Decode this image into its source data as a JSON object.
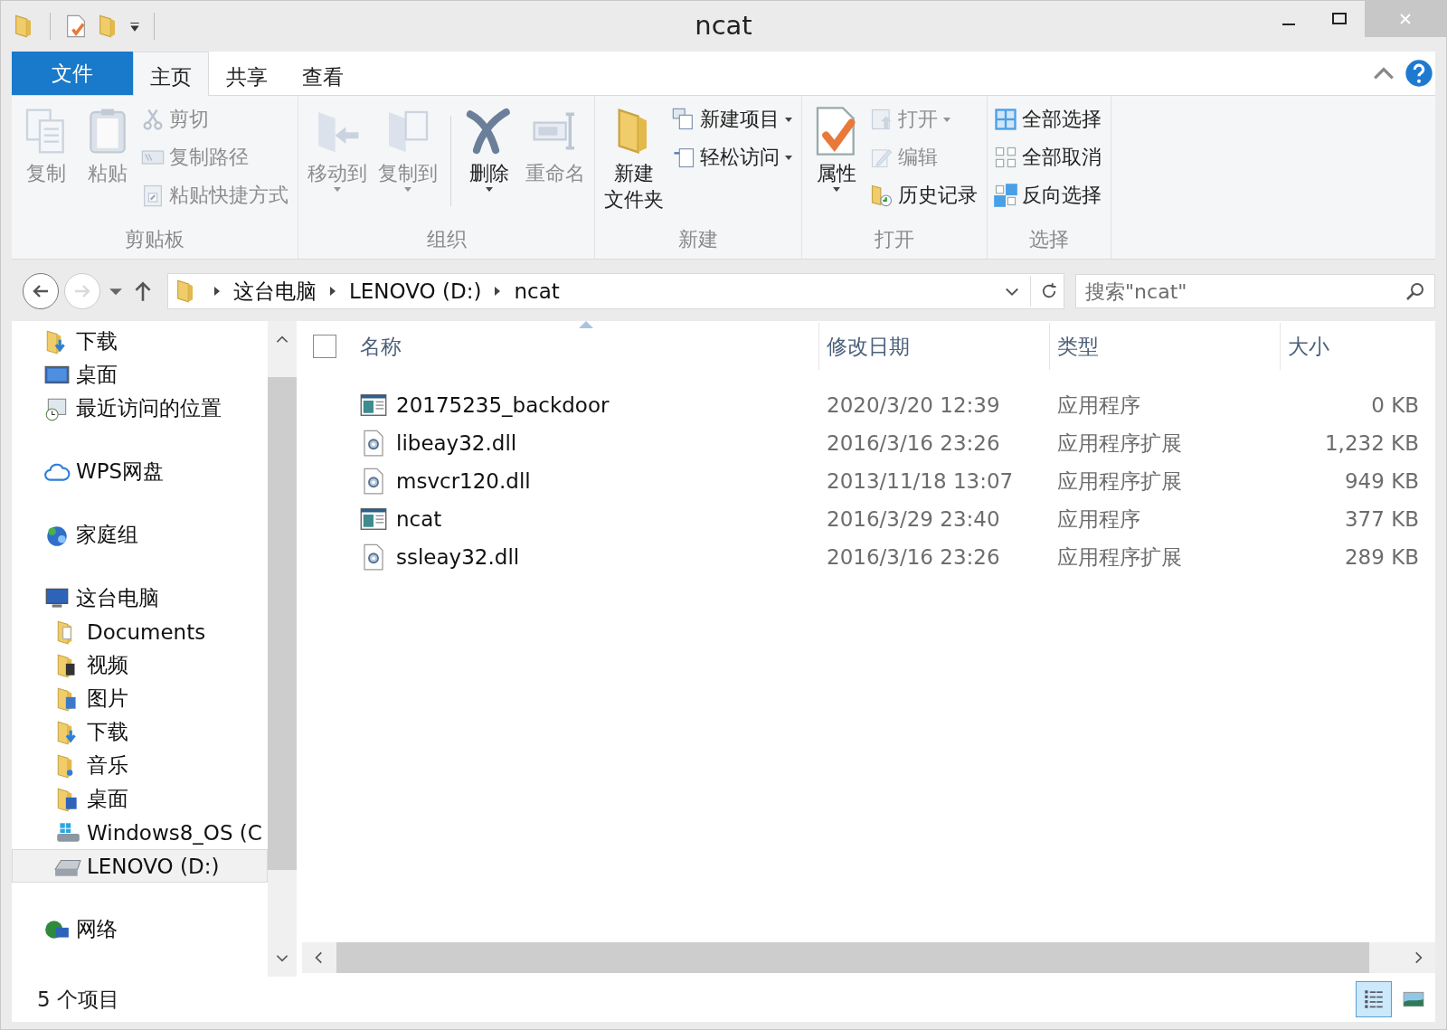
{
  "window": {
    "title": "ncat"
  },
  "tabs": [
    {
      "label": "文件",
      "kind": "file",
      "selected": false
    },
    {
      "label": "主页",
      "kind": "tab",
      "selected": true
    },
    {
      "label": "共享",
      "kind": "tab",
      "selected": false
    },
    {
      "label": "查看",
      "kind": "tab",
      "selected": false
    }
  ],
  "ribbon": {
    "groups": [
      {
        "label": "剪贴板",
        "items": [
          {
            "kind": "large",
            "lines": [
              "复制"
            ],
            "disabled": true,
            "dropdown": false
          },
          {
            "kind": "large",
            "lines": [
              "粘贴"
            ],
            "disabled": true,
            "dropdown": false
          },
          {
            "kind": "stack",
            "items": [
              {
                "label": "剪切",
                "disabled": true,
                "dropdown": false
              },
              {
                "label": "复制路径",
                "disabled": true,
                "dropdown": false
              },
              {
                "label": "粘贴快捷方式",
                "disabled": true,
                "dropdown": false
              }
            ]
          }
        ]
      },
      {
        "label": "组织",
        "items": [
          {
            "kind": "large",
            "lines": [
              "移动到"
            ],
            "disabled": true,
            "dropdown": true
          },
          {
            "kind": "large",
            "lines": [
              "复制到"
            ],
            "disabled": true,
            "dropdown": true
          },
          {
            "kind": "large",
            "lines": [
              "删除"
            ],
            "disabled": false,
            "dropdown": true
          },
          {
            "kind": "large",
            "lines": [
              "重命名"
            ],
            "disabled": true,
            "dropdown": false
          }
        ]
      },
      {
        "label": "新建",
        "items": [
          {
            "kind": "large",
            "lines": [
              "新建",
              "文件夹"
            ],
            "disabled": false,
            "dropdown": false
          },
          {
            "kind": "stack",
            "items": [
              {
                "label": "新建项目",
                "disabled": false,
                "dropdown": true
              },
              {
                "label": "轻松访问",
                "disabled": false,
                "dropdown": true
              }
            ]
          }
        ]
      },
      {
        "label": "打开",
        "items": [
          {
            "kind": "large",
            "lines": [
              "属性"
            ],
            "disabled": false,
            "dropdown": true
          },
          {
            "kind": "stack",
            "items": [
              {
                "label": "打开",
                "disabled": true,
                "dropdown": true
              },
              {
                "label": "编辑",
                "disabled": true,
                "dropdown": false
              },
              {
                "label": "历史记录",
                "disabled": false,
                "dropdown": false
              }
            ]
          }
        ]
      },
      {
        "label": "选择",
        "items": [
          {
            "kind": "stack",
            "items": [
              {
                "label": "全部选择",
                "disabled": false,
                "dropdown": false
              },
              {
                "label": "全部取消",
                "disabled": false,
                "dropdown": false
              },
              {
                "label": "反向选择",
                "disabled": false,
                "dropdown": false
              }
            ]
          }
        ]
      }
    ]
  },
  "navigation": {
    "back_disabled": false,
    "forward_disabled": true
  },
  "breadcrumb": [
    "这台电脑",
    "LENOVO (D:)",
    "ncat"
  ],
  "search": {
    "placeholder": "搜索\"ncat\""
  },
  "sidebar": {
    "items": [
      {
        "label": "下载",
        "kind": "downloads",
        "selected": false
      },
      {
        "label": "桌面",
        "kind": "desktop",
        "selected": false
      },
      {
        "label": "最近访问的位置",
        "kind": "recent",
        "selected": false
      },
      {
        "label": "WPS网盘",
        "kind": "cloud",
        "selected": false
      },
      {
        "label": "家庭组",
        "kind": "homegroup",
        "selected": false
      },
      {
        "label": "这台电脑",
        "kind": "computer",
        "selected": false,
        "children": [
          {
            "label": "Documents",
            "kind": "documents",
            "selected": false
          },
          {
            "label": "视频",
            "kind": "videos",
            "selected": false
          },
          {
            "label": "图片",
            "kind": "pictures",
            "selected": false
          },
          {
            "label": "下载",
            "kind": "downloads",
            "selected": false
          },
          {
            "label": "音乐",
            "kind": "music",
            "selected": false
          },
          {
            "label": "桌面",
            "kind": "desktopfolder",
            "selected": false
          },
          {
            "label": "Windows8_OS (C",
            "kind": "osdrive",
            "selected": false
          },
          {
            "label": "LENOVO (D:)",
            "kind": "drive",
            "selected": true
          }
        ]
      },
      {
        "label": "网络",
        "kind": "network",
        "selected": false
      }
    ]
  },
  "table": {
    "select_all": {
      "checked": false
    },
    "columns": [
      {
        "label": "名称",
        "sorted": true
      },
      {
        "label": "修改日期",
        "sorted": false
      },
      {
        "label": "类型",
        "sorted": false
      },
      {
        "label": "大小",
        "sorted": false
      }
    ],
    "rows": [
      {
        "kind": "exe",
        "name": "20175235_backdoor",
        "date": "2020/3/20 12:39",
        "type": "应用程序",
        "size": "0 KB"
      },
      {
        "kind": "dll",
        "name": "libeay32.dll",
        "date": "2016/3/16 23:26",
        "type": "应用程序扩展",
        "size": "1,232 KB"
      },
      {
        "kind": "dll",
        "name": "msvcr120.dll",
        "date": "2013/11/18 13:07",
        "type": "应用程序扩展",
        "size": "949 KB"
      },
      {
        "kind": "exe",
        "name": "ncat",
        "date": "2016/3/29 23:40",
        "type": "应用程序",
        "size": "377 KB"
      },
      {
        "kind": "dll",
        "name": "ssleay32.dll",
        "date": "2016/3/16 23:26",
        "type": "应用程序扩展",
        "size": "289 KB"
      }
    ]
  },
  "status_bar": {
    "text": "5 个项目"
  },
  "view_buttons": [
    {
      "kind": "details",
      "selected": true
    },
    {
      "kind": "large_icons",
      "selected": false
    }
  ]
}
